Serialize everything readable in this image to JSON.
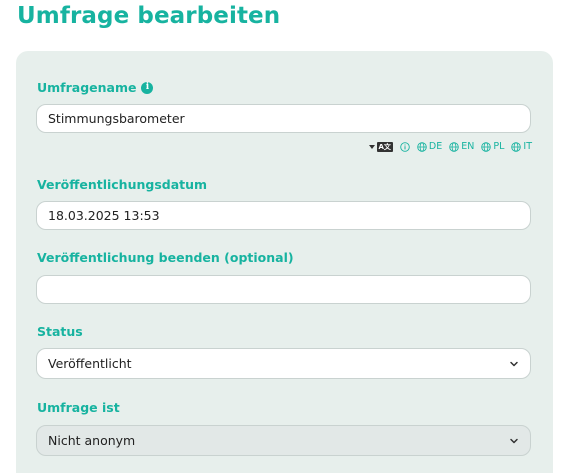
{
  "page_title": "Umfrage bearbeiten",
  "fields": {
    "name": {
      "label": "Umfragename",
      "value": "Stimmungsbarometer"
    },
    "publish_date": {
      "label": "Veröffentlichungsdatum",
      "value": "18.03.2025 13:53"
    },
    "publish_end": {
      "label": "Veröffentlichung beenden (optional)",
      "value": ""
    },
    "status": {
      "label": "Status",
      "selected": "Veröffentlicht"
    },
    "anonymity": {
      "label": "Umfrage ist",
      "selected": "Nicht anonym"
    }
  },
  "languages": [
    "DE",
    "EN",
    "PL",
    "IT"
  ],
  "translate_icon_text": "A文",
  "colors": {
    "accent": "#17b3a0",
    "card_bg": "#e7efec"
  }
}
